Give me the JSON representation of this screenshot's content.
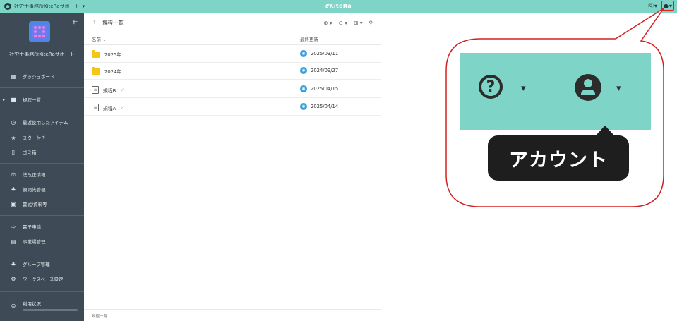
{
  "topbar": {
    "workspace_name": "社労士事務所KiteRaサポート",
    "workspace_caret": "▾",
    "app_title": "𝒪KiteRa",
    "help_icon": "help-circle-icon",
    "account_icon": "account-circle-icon",
    "caret": "▾"
  },
  "sidebar": {
    "org_name": "社労士事務所KiteRaサポート",
    "items": [
      {
        "label": "ダッシュボード",
        "icon": "dashboard-icon",
        "glyph": "▦"
      },
      {
        "label": "規程一覧",
        "icon": "folder-icon",
        "glyph": "■"
      },
      {
        "label": "最近使用したアイテム",
        "icon": "clock-icon",
        "glyph": "◷"
      },
      {
        "label": "スター付き",
        "icon": "star-icon",
        "glyph": "★"
      },
      {
        "label": "ゴミ箱",
        "icon": "trash-icon",
        "glyph": "🗑"
      },
      {
        "label": "法改正情報",
        "icon": "law-icon",
        "glyph": "⚖"
      },
      {
        "label": "顧問先管理",
        "icon": "people-icon",
        "glyph": "👥"
      },
      {
        "label": "書式/資料等",
        "icon": "document-icon",
        "glyph": "▣"
      },
      {
        "label": "電子申請",
        "icon": "e-application-icon",
        "glyph": "⇨"
      },
      {
        "label": "事業場管理",
        "icon": "office-icon",
        "glyph": "▤"
      },
      {
        "label": "グループ管理",
        "icon": "group-icon",
        "glyph": "👥"
      },
      {
        "label": "ワークスペース設定",
        "icon": "gear-icon",
        "glyph": "⚙"
      },
      {
        "label": "利用状況",
        "icon": "database-icon",
        "glyph": "⊜"
      }
    ]
  },
  "main": {
    "title": "規程一覧",
    "up_arrow": "↑",
    "actions": [
      "⊕ ▾",
      "⊖ ▾",
      "⊞ ▾",
      "⚲"
    ],
    "columns": {
      "name": "名前 ⌄",
      "updated": "最終更新"
    },
    "rows": [
      {
        "name": "2025年",
        "type": "folder",
        "updated": "2025/03/11"
      },
      {
        "name": "2024年",
        "type": "folder",
        "updated": "2024/09/27"
      },
      {
        "name": "規程B",
        "type": "document",
        "updated": "2025/04/15"
      },
      {
        "name": "規程A",
        "type": "document",
        "updated": "2025/04/14"
      }
    ],
    "footer": "規程一覧"
  },
  "callout": {
    "tooltip": "アカウント",
    "caret": "▾",
    "help_symbol": "?"
  },
  "colors": {
    "topbar": "#7fd4c8",
    "sidebar": "#3e4a55",
    "highlight": "#e02020",
    "folder": "#f5c518"
  }
}
